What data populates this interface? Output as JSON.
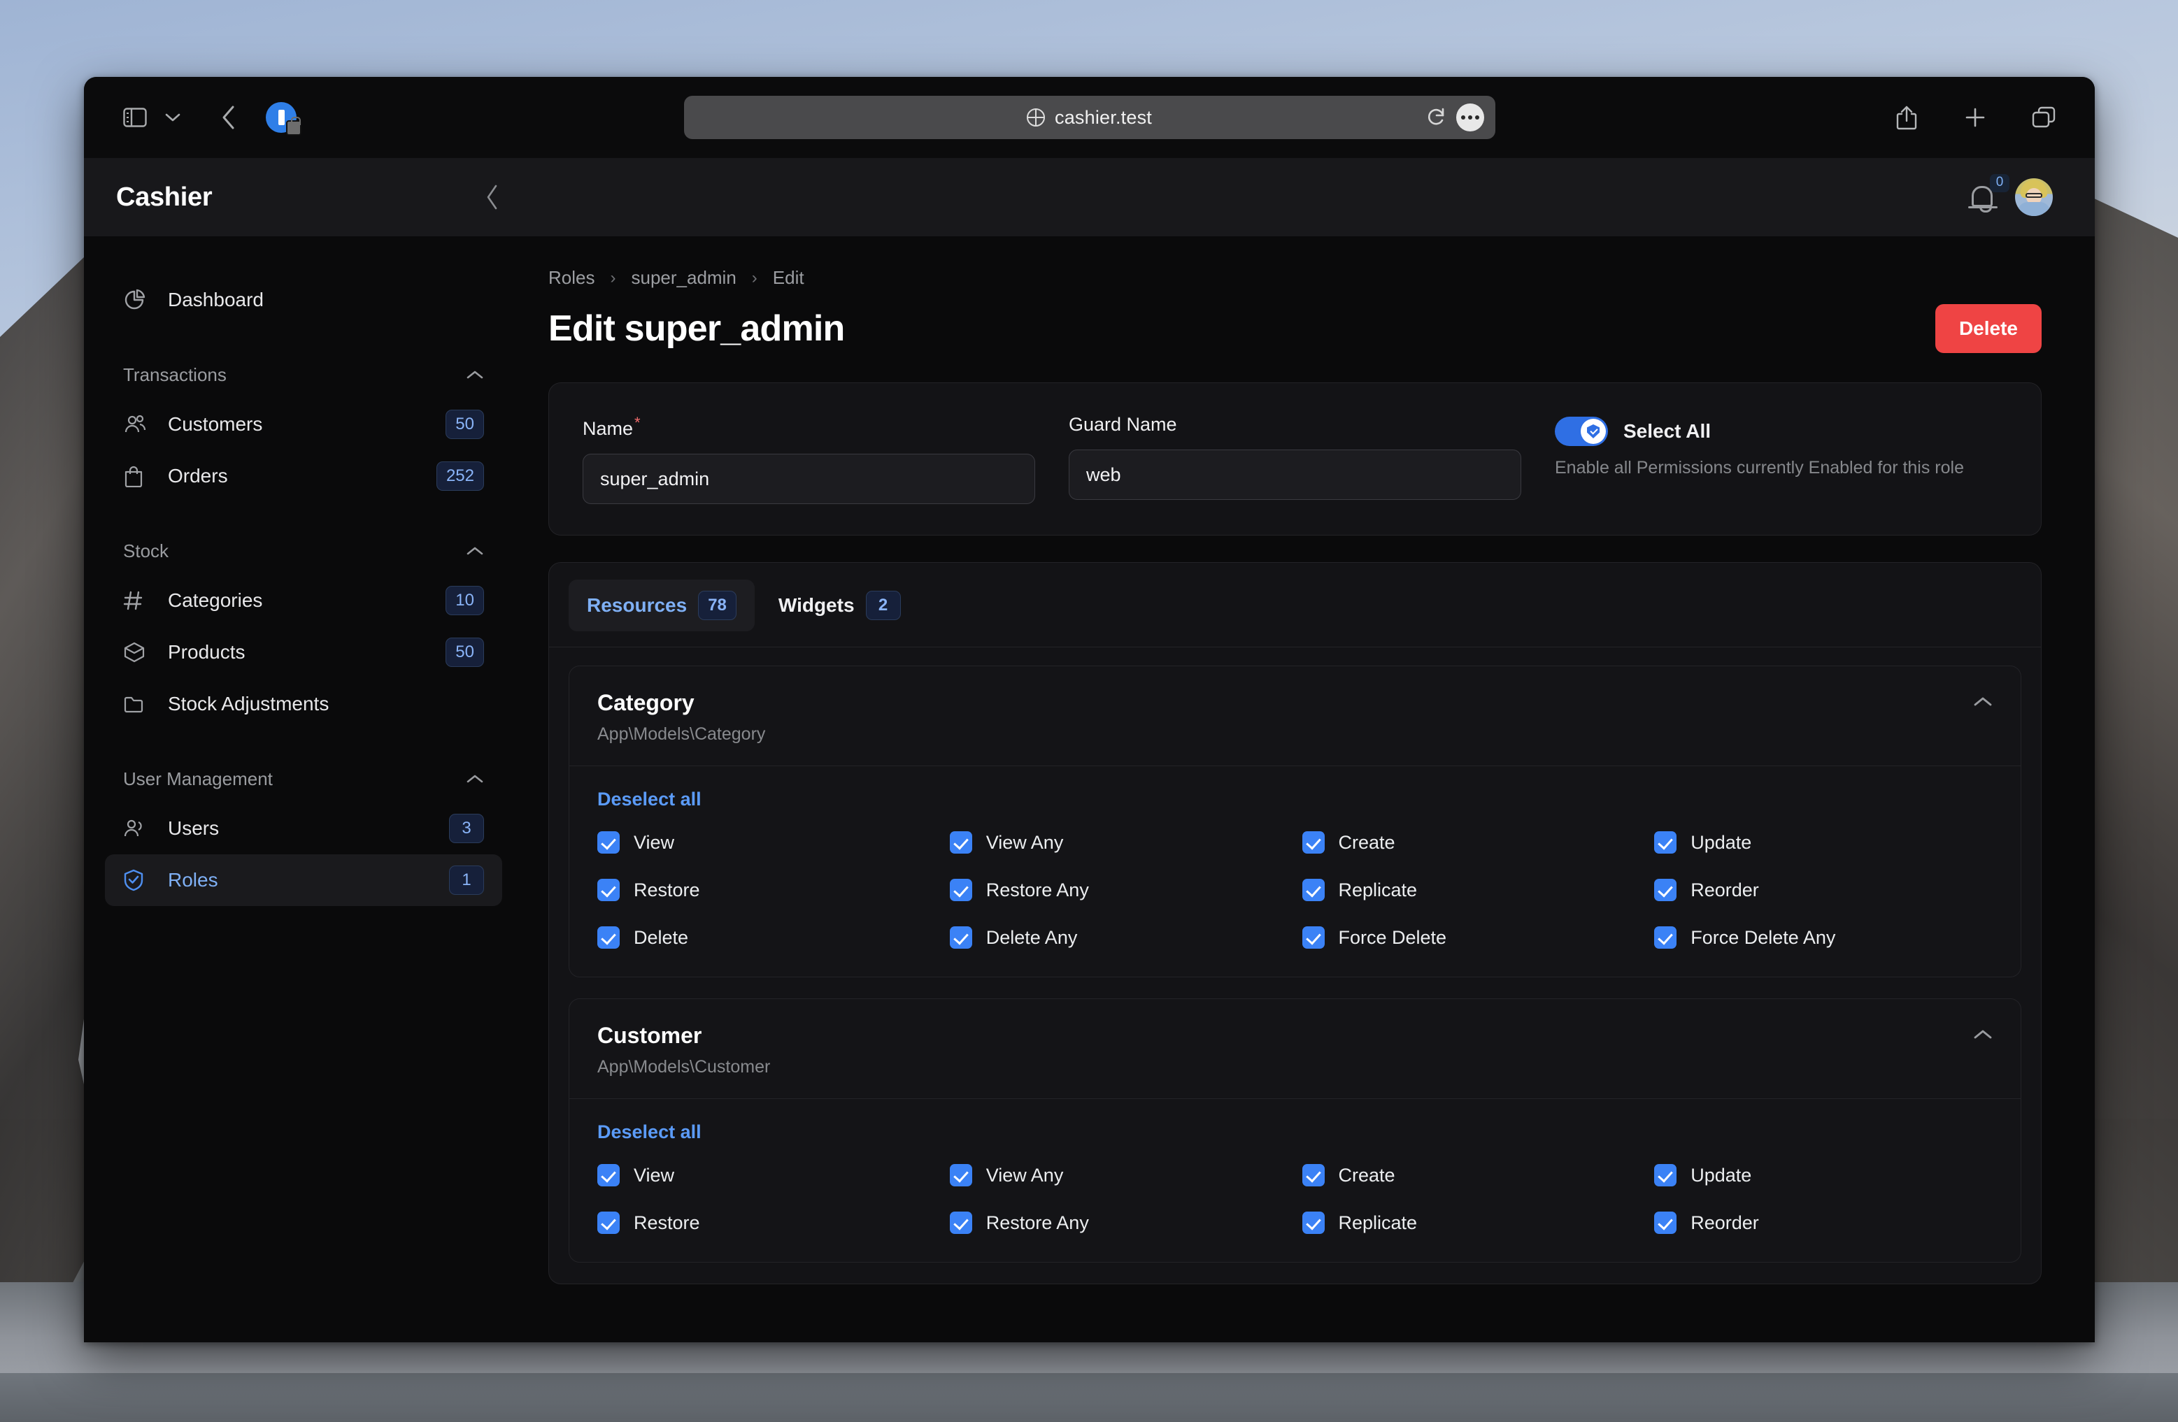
{
  "browser": {
    "url": "cashier.test",
    "icons": {
      "sidebar_toggle": "sidebar-toggle-icon",
      "tab_overview_chevron": "chevron-down-icon",
      "back": "back-chevron-icon",
      "favicon": "site-favicon-lock-icon",
      "globe": "globe-icon",
      "reload": "reload-icon",
      "more": "more-options-icon",
      "share": "share-icon",
      "new_tab": "plus-icon",
      "tabs": "tabs-icon"
    }
  },
  "app": {
    "brand": "Cashier",
    "collapse_icon": "chevron-left-icon",
    "notifications_count": "0",
    "avatar_name": "user-avatar"
  },
  "sidebar": {
    "dashboard": {
      "label": "Dashboard",
      "icon": "pie-chart-icon"
    },
    "groups": [
      {
        "title": "Transactions",
        "items": [
          {
            "label": "Customers",
            "badge": "50",
            "icon": "users-group-icon"
          },
          {
            "label": "Orders",
            "badge": "252",
            "icon": "shopping-bag-icon"
          }
        ]
      },
      {
        "title": "Stock",
        "items": [
          {
            "label": "Categories",
            "badge": "10",
            "icon": "hash-icon"
          },
          {
            "label": "Products",
            "badge": "50",
            "icon": "cube-icon"
          },
          {
            "label": "Stock Adjustments",
            "badge": "",
            "icon": "folder-icon"
          }
        ]
      },
      {
        "title": "User Management",
        "items": [
          {
            "label": "Users",
            "badge": "3",
            "icon": "users-icon"
          },
          {
            "label": "Roles",
            "badge": "1",
            "icon": "shield-check-icon"
          }
        ]
      }
    ],
    "active_item": "Roles"
  },
  "page": {
    "breadcrumb": [
      "Roles",
      "super_admin",
      "Edit"
    ],
    "title": "Edit super_admin",
    "delete_label": "Delete"
  },
  "form": {
    "name_label": "Name",
    "name_required_mark": "*",
    "name_value": "super_admin",
    "guard_label": "Guard Name",
    "guard_value": "web",
    "select_all_label": "Select All",
    "select_all_help": "Enable all Permissions currently Enabled for this role",
    "select_all_on": true
  },
  "tabs": [
    {
      "label": "Resources",
      "badge": "78",
      "active": true
    },
    {
      "label": "Widgets",
      "badge": "2",
      "active": false
    }
  ],
  "panels": [
    {
      "title": "Category",
      "model": "App\\Models\\Category",
      "deselect_label": "Deselect all",
      "permissions": [
        "View",
        "View Any",
        "Create",
        "Update",
        "Restore",
        "Restore Any",
        "Replicate",
        "Reorder",
        "Delete",
        "Delete Any",
        "Force Delete",
        "Force Delete Any"
      ]
    },
    {
      "title": "Customer",
      "model": "App\\Models\\Customer",
      "deselect_label": "Deselect all",
      "permissions": [
        "View",
        "View Any",
        "Create",
        "Update",
        "Restore",
        "Restore Any",
        "Replicate",
        "Reorder"
      ]
    }
  ],
  "colors": {
    "accent_blue": "#3b82f6",
    "link_blue": "#5b9bf8",
    "danger_red": "#ef4444",
    "panel_bg": "#141417",
    "card_bg": "#131316",
    "app_bg": "#0a0a0b"
  }
}
